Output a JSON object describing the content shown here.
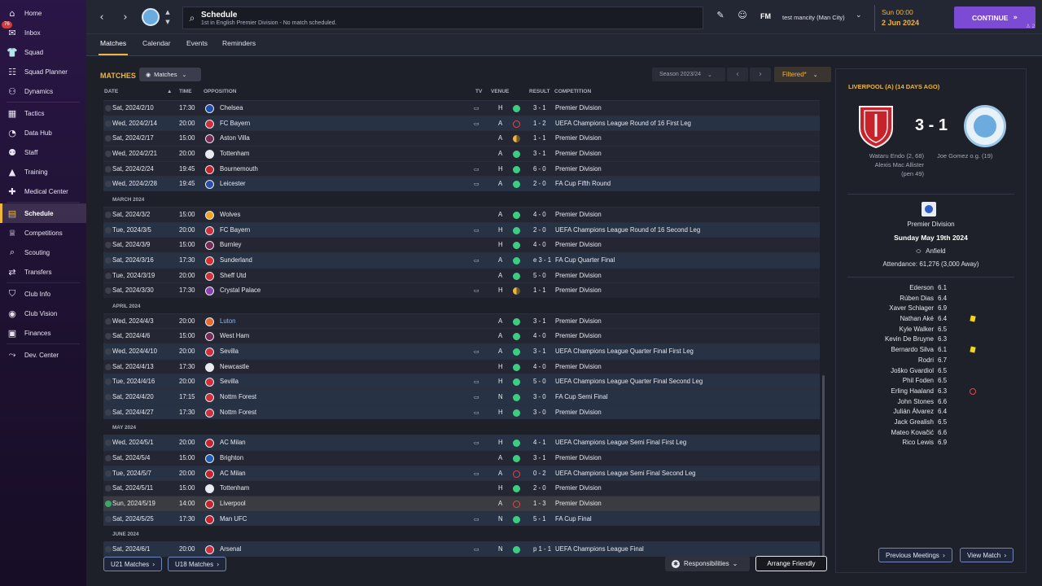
{
  "sidebar": {
    "items": [
      {
        "label": "Home",
        "icon": "⌂",
        "icon_name": "home-icon"
      },
      {
        "label": "Inbox",
        "icon": "✉",
        "icon_name": "inbox-icon",
        "badge": "76"
      },
      {
        "label": "Squad",
        "icon": "👕",
        "icon_name": "shirt-icon"
      },
      {
        "label": "Squad Planner",
        "icon": "☷",
        "icon_name": "planner-icon"
      },
      {
        "label": "Dynamics",
        "icon": "⚇",
        "icon_name": "dynamics-icon"
      },
      {
        "label": "Tactics",
        "icon": "▦",
        "icon_name": "tactics-icon"
      },
      {
        "label": "Data Hub",
        "icon": "◔",
        "icon_name": "data-hub-icon"
      },
      {
        "label": "Staff",
        "icon": "⚉",
        "icon_name": "staff-icon"
      },
      {
        "label": "Training",
        "icon": "▲",
        "icon_name": "training-icon"
      },
      {
        "label": "Medical Center",
        "icon": "✚",
        "icon_name": "medical-icon"
      },
      {
        "label": "Schedule",
        "icon": "▤",
        "icon_name": "calendar-icon"
      },
      {
        "label": "Competitions",
        "icon": "♕",
        "icon_name": "trophy-icon"
      },
      {
        "label": "Scouting",
        "icon": "⌕",
        "icon_name": "scouting-icon"
      },
      {
        "label": "Transfers",
        "icon": "⇄",
        "icon_name": "transfers-icon"
      },
      {
        "label": "Club Info",
        "icon": "⛉",
        "icon_name": "club-info-icon"
      },
      {
        "label": "Club Vision",
        "icon": "◉",
        "icon_name": "club-vision-icon"
      },
      {
        "label": "Finances",
        "icon": "▣",
        "icon_name": "finances-icon"
      },
      {
        "label": "Dev. Center",
        "icon": "⤳",
        "icon_name": "dev-center-icon"
      }
    ],
    "active": "Schedule"
  },
  "topbar": {
    "title": "Schedule",
    "subtitle": "1st in English Premier Division - No match scheduled.",
    "fm_logo": "FM",
    "profile": "test mancity (Man City)",
    "time": "Sun 00:00",
    "date": "2 Jun 2024",
    "continue": "CONTINUE",
    "people_count": "2"
  },
  "tabs": [
    "Matches",
    "Calendar",
    "Events",
    "Reminders"
  ],
  "main": {
    "heading": "MATCHES",
    "view_dropdown": "Matches",
    "season": "Season 2023/24",
    "filter": "Filtered*",
    "columns": {
      "date": "DATE",
      "time": "TIME",
      "opposition": "OPPOSITION",
      "tv": "TV",
      "venue": "VENUE",
      "result": "RESULT",
      "competition": "COMPETITION"
    },
    "rows": [
      {
        "type": "match",
        "date": "Sat, 2024/2/10",
        "time": "17:30",
        "opp": "Chelsea",
        "tv": true,
        "venue": "H",
        "res": "win",
        "score": "3 - 1",
        "comp": "Premier Division",
        "crest": "#1c4fb0"
      },
      {
        "type": "match",
        "date": "Wed, 2024/2/14",
        "time": "20:00",
        "opp": "FC Bayern",
        "tv": true,
        "venue": "A",
        "res": "loss",
        "score": "1 - 2",
        "comp": "UEFA Champions League Round of 16 First Leg",
        "crest": "#d0303a",
        "hl": true
      },
      {
        "type": "match",
        "date": "Sat, 2024/2/17",
        "time": "15:00",
        "opp": "Aston Villa",
        "tv": false,
        "venue": "A",
        "res": "draw",
        "score": "1 - 1",
        "comp": "Premier Division",
        "crest": "#7a2b53"
      },
      {
        "type": "match",
        "date": "Wed, 2024/2/21",
        "time": "20:00",
        "opp": "Tottenham",
        "tv": false,
        "venue": "A",
        "res": "win",
        "score": "3 - 1",
        "comp": "Premier Division",
        "crest": "#e9ecf2"
      },
      {
        "type": "match",
        "date": "Sat, 2024/2/24",
        "time": "19:45",
        "opp": "Bournemouth",
        "tv": true,
        "venue": "H",
        "res": "win",
        "score": "6 - 0",
        "comp": "Premier Division",
        "crest": "#c8232c"
      },
      {
        "type": "match",
        "date": "Wed, 2024/2/28",
        "time": "19:45",
        "opp": "Leicester",
        "tv": true,
        "venue": "A",
        "res": "win",
        "score": "2 - 0",
        "comp": "FA Cup Fifth Round",
        "crest": "#2a4fa8",
        "hl": true
      },
      {
        "type": "month",
        "label": "MARCH 2024"
      },
      {
        "type": "match",
        "date": "Sat, 2024/3/2",
        "time": "15:00",
        "opp": "Wolves",
        "tv": false,
        "venue": "A",
        "res": "win",
        "score": "4 - 0",
        "comp": "Premier Division",
        "crest": "#f1a420"
      },
      {
        "type": "match",
        "date": "Tue, 2024/3/5",
        "time": "20:00",
        "opp": "FC Bayern",
        "tv": true,
        "venue": "H",
        "res": "win",
        "score": "2 - 0",
        "comp": "UEFA Champions League Round of 16 Second Leg",
        "crest": "#d0303a",
        "hl": true
      },
      {
        "type": "match",
        "date": "Sat, 2024/3/9",
        "time": "15:00",
        "opp": "Burnley",
        "tv": false,
        "venue": "H",
        "res": "win",
        "score": "4 - 0",
        "comp": "Premier Division",
        "crest": "#7a2b53"
      },
      {
        "type": "match",
        "date": "Sat, 2024/3/16",
        "time": "17:30",
        "opp": "Sunderland",
        "tv": true,
        "venue": "A",
        "res": "win",
        "score": "e 3 - 1",
        "comp": "FA Cup Quarter Final",
        "crest": "#d3302f",
        "hl": true
      },
      {
        "type": "match",
        "date": "Tue, 2024/3/19",
        "time": "20:00",
        "opp": "Sheff Utd",
        "tv": false,
        "venue": "A",
        "res": "win",
        "score": "5 - 0",
        "comp": "Premier Division",
        "crest": "#d0303a"
      },
      {
        "type": "match",
        "date": "Sat, 2024/3/30",
        "time": "17:30",
        "opp": "Crystal Palace",
        "tv": true,
        "venue": "H",
        "res": "draw",
        "score": "1 - 1",
        "comp": "Premier Division",
        "crest": "#8c3fb4"
      },
      {
        "type": "month",
        "label": "APRIL 2024"
      },
      {
        "type": "match",
        "date": "Wed, 2024/4/3",
        "time": "20:00",
        "opp": "Luton",
        "opp_color": "#8fb4ef",
        "tv": false,
        "venue": "A",
        "res": "win",
        "score": "3 - 1",
        "comp": "Premier Division",
        "crest": "#e86a2a"
      },
      {
        "type": "match",
        "date": "Sat, 2024/4/6",
        "time": "15:00",
        "opp": "West Ham",
        "tv": false,
        "venue": "A",
        "res": "win",
        "score": "4 - 0",
        "comp": "Premier Division",
        "crest": "#7a2b53"
      },
      {
        "type": "match",
        "date": "Wed, 2024/4/10",
        "time": "20:00",
        "opp": "Sevilla",
        "tv": true,
        "venue": "A",
        "res": "win",
        "score": "3 - 1",
        "comp": "UEFA Champions League Quarter Final First Leg",
        "crest": "#d0303a",
        "hl": true
      },
      {
        "type": "match",
        "date": "Sat, 2024/4/13",
        "time": "17:30",
        "opp": "Newcastle",
        "tv": false,
        "venue": "H",
        "res": "win",
        "score": "4 - 0",
        "comp": "Premier Division",
        "crest": "#e9ecf2"
      },
      {
        "type": "match",
        "date": "Tue, 2024/4/16",
        "time": "20:00",
        "opp": "Sevilla",
        "tv": true,
        "venue": "H",
        "res": "win",
        "score": "5 - 0",
        "comp": "UEFA Champions League Quarter Final Second Leg",
        "crest": "#d0303a",
        "hl": true
      },
      {
        "type": "match",
        "date": "Sat, 2024/4/20",
        "time": "17:15",
        "opp": "Nottm Forest",
        "tv": true,
        "venue": "N",
        "res": "win",
        "score": "3 - 0",
        "comp": "FA Cup Semi Final",
        "crest": "#d0303a",
        "hl": true
      },
      {
        "type": "match",
        "date": "Sat, 2024/4/27",
        "time": "17:30",
        "opp": "Nottm Forest",
        "tv": true,
        "venue": "H",
        "res": "win",
        "score": "3 - 0",
        "comp": "Premier Division",
        "crest": "#d0303a",
        "hl": true
      },
      {
        "type": "month",
        "label": "MAY 2024"
      },
      {
        "type": "match",
        "date": "Wed, 2024/5/1",
        "time": "20:00",
        "opp": "AC Milan",
        "tv": true,
        "venue": "H",
        "res": "win",
        "score": "4 - 1",
        "comp": "UEFA Champions League Semi Final First Leg",
        "crest": "#c8232c",
        "hl": true
      },
      {
        "type": "match",
        "date": "Sat, 2024/5/4",
        "time": "15:00",
        "opp": "Brighton",
        "tv": false,
        "venue": "A",
        "res": "win",
        "score": "3 - 1",
        "comp": "Premier Division",
        "crest": "#1c5fb8"
      },
      {
        "type": "match",
        "date": "Tue, 2024/5/7",
        "time": "20:00",
        "opp": "AC Milan",
        "tv": true,
        "venue": "A",
        "res": "loss",
        "score": "0 - 2",
        "comp": "UEFA Champions League Semi Final Second Leg",
        "crest": "#c8232c",
        "hl": true
      },
      {
        "type": "match",
        "date": "Sat, 2024/5/11",
        "time": "15:00",
        "opp": "Tottenham",
        "tv": false,
        "venue": "H",
        "res": "win",
        "score": "2 - 0",
        "comp": "Premier Division",
        "crest": "#e9ecf2"
      },
      {
        "type": "match",
        "date": "Sun, 2024/5/19",
        "time": "14:00",
        "opp": "Liverpool",
        "tv": false,
        "venue": "A",
        "res": "loss",
        "score": "1 - 3",
        "comp": "Premier Division",
        "crest": "#c8232c",
        "sel": true
      },
      {
        "type": "match",
        "date": "Sat, 2024/5/25",
        "time": "17:30",
        "opp": "Man UFC",
        "tv": true,
        "venue": "N",
        "res": "win",
        "score": "5 - 1",
        "comp": "FA Cup Final",
        "crest": "#c8232c",
        "hl": true
      },
      {
        "type": "month",
        "label": "JUNE 2024"
      },
      {
        "type": "match",
        "date": "Sat, 2024/6/1",
        "time": "20:00",
        "opp": "Arsenal",
        "tv": true,
        "venue": "N",
        "res": "win",
        "score": "p 1 - 1",
        "comp": "UEFA Champions League Final",
        "crest": "#d0303a",
        "hl": true
      }
    ],
    "u21": "U21 Matches",
    "u18": "U18 Matches",
    "responsibilities": "Responsibilities",
    "arrange_friendly": "Arrange Friendly"
  },
  "panel": {
    "title": "LIVERPOOL (A) (14 DAYS AGO)",
    "score": "3 - 1",
    "home_scorers": [
      "Wataru Endo (2, 68)",
      "Alexis Mac Allister",
      "(pen 49)"
    ],
    "away_scorers": [
      "Joe Gomez o.g. (19)"
    ],
    "competition": "Premier Division",
    "date": "Sunday May 19th 2024",
    "venue": "Anfield",
    "attendance": "Attendance: 61,276 (3,000 Away)",
    "ratings": [
      {
        "name": "Ederson",
        "rating": "6.1"
      },
      {
        "name": "Rúben Dias",
        "rating": "6.4"
      },
      {
        "name": "Xaver Schlager",
        "rating": "6.9"
      },
      {
        "name": "Nathan Aké",
        "rating": "6.4",
        "mark": "yellow"
      },
      {
        "name": "Kyle Walker",
        "rating": "6.5"
      },
      {
        "name": "Kevin De Bruyne",
        "rating": "6.3"
      },
      {
        "name": "Bernardo Silva",
        "rating": "6.1",
        "mark": "yellow"
      },
      {
        "name": "Rodri",
        "rating": "6.7"
      },
      {
        "name": "Joško Gvardiol",
        "rating": "6.5"
      },
      {
        "name": "Phil Foden",
        "rating": "6.5"
      },
      {
        "name": "Erling Haaland",
        "rating": "6.3",
        "mark": "red"
      },
      {
        "name": "John Stones",
        "rating": "6.6"
      },
      {
        "name": "Julián Álvarez",
        "rating": "6.4"
      },
      {
        "name": "Jack Grealish",
        "rating": "6.5"
      },
      {
        "name": "Mateo Kovačić",
        "rating": "6.6"
      },
      {
        "name": "Rico Lewis",
        "rating": "6.9"
      }
    ],
    "previous_meetings": "Previous Meetings",
    "view_match": "View Match"
  }
}
